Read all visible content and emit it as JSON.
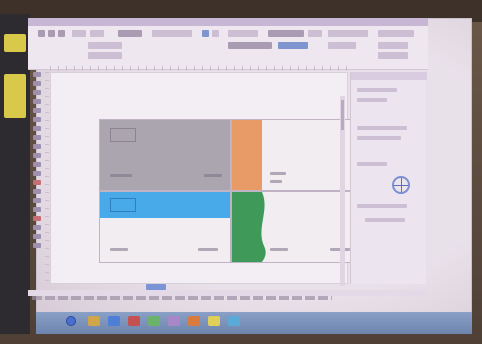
{
  "window": {
    "title": ""
  },
  "colors": {
    "accent_gray": "#a8a3ac",
    "accent_orange": "#e69a66",
    "accent_blue": "#48a9e8",
    "accent_green": "#3f9a5a",
    "taskbar": "#7a90ba"
  },
  "ribbon": {
    "font_name": "",
    "font_size": ""
  },
  "tools": [
    "select-icon",
    "shape-icon",
    "text-icon",
    "pen-icon",
    "fill-icon",
    "zoom-icon"
  ],
  "cards": [
    {
      "accent": "gray",
      "logo": "",
      "company": "",
      "tagline": "",
      "name": "",
      "title": ""
    },
    {
      "accent": "orange",
      "company": "",
      "tagline": "",
      "name": "",
      "title": ""
    },
    {
      "accent": "blue",
      "company": "",
      "tagline": "",
      "name": "",
      "title": ""
    },
    {
      "accent": "green",
      "company": "",
      "tagline": "",
      "name": "",
      "title": ""
    }
  ],
  "properties_panel": {
    "title": ""
  },
  "page_tab": "",
  "taskbar": {
    "clock": ""
  }
}
